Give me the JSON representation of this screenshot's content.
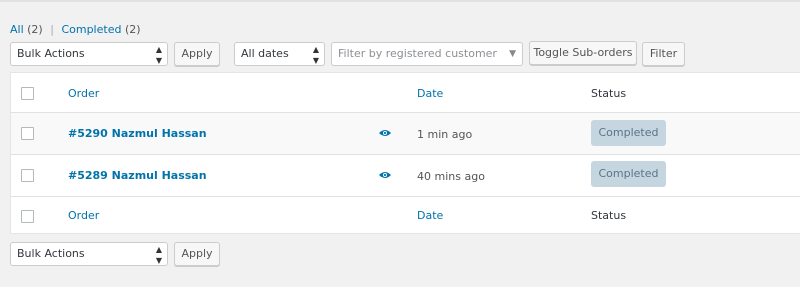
{
  "filters": {
    "all_label": "All",
    "all_count": "(2)",
    "separator": "|",
    "completed_label": "Completed",
    "completed_count": "(2)"
  },
  "top_nav": {
    "bulk_actions": "Bulk Actions",
    "apply_label": "Apply",
    "dates": "All dates",
    "customer_placeholder": "Filter by registered customer",
    "toggle_suborders": "Toggle Sub-orders",
    "filter_label": "Filter"
  },
  "table": {
    "headers": {
      "order": "Order",
      "date": "Date",
      "status": "Status"
    },
    "rows": [
      {
        "order": "#5290 Nazmul Hassan",
        "date": "1 min ago",
        "status": "Completed"
      },
      {
        "order": "#5289 Nazmul Hassan",
        "date": "40 mins ago",
        "status": "Completed"
      }
    ],
    "footers": {
      "order": "Order",
      "date": "Date",
      "status": "Status"
    }
  },
  "bottom_nav": {
    "bulk_actions": "Bulk Actions",
    "apply_label": "Apply"
  },
  "colors": {
    "link": "#0073aa",
    "badge_bg": "#c6d6e0",
    "badge_text": "#5b7487"
  }
}
